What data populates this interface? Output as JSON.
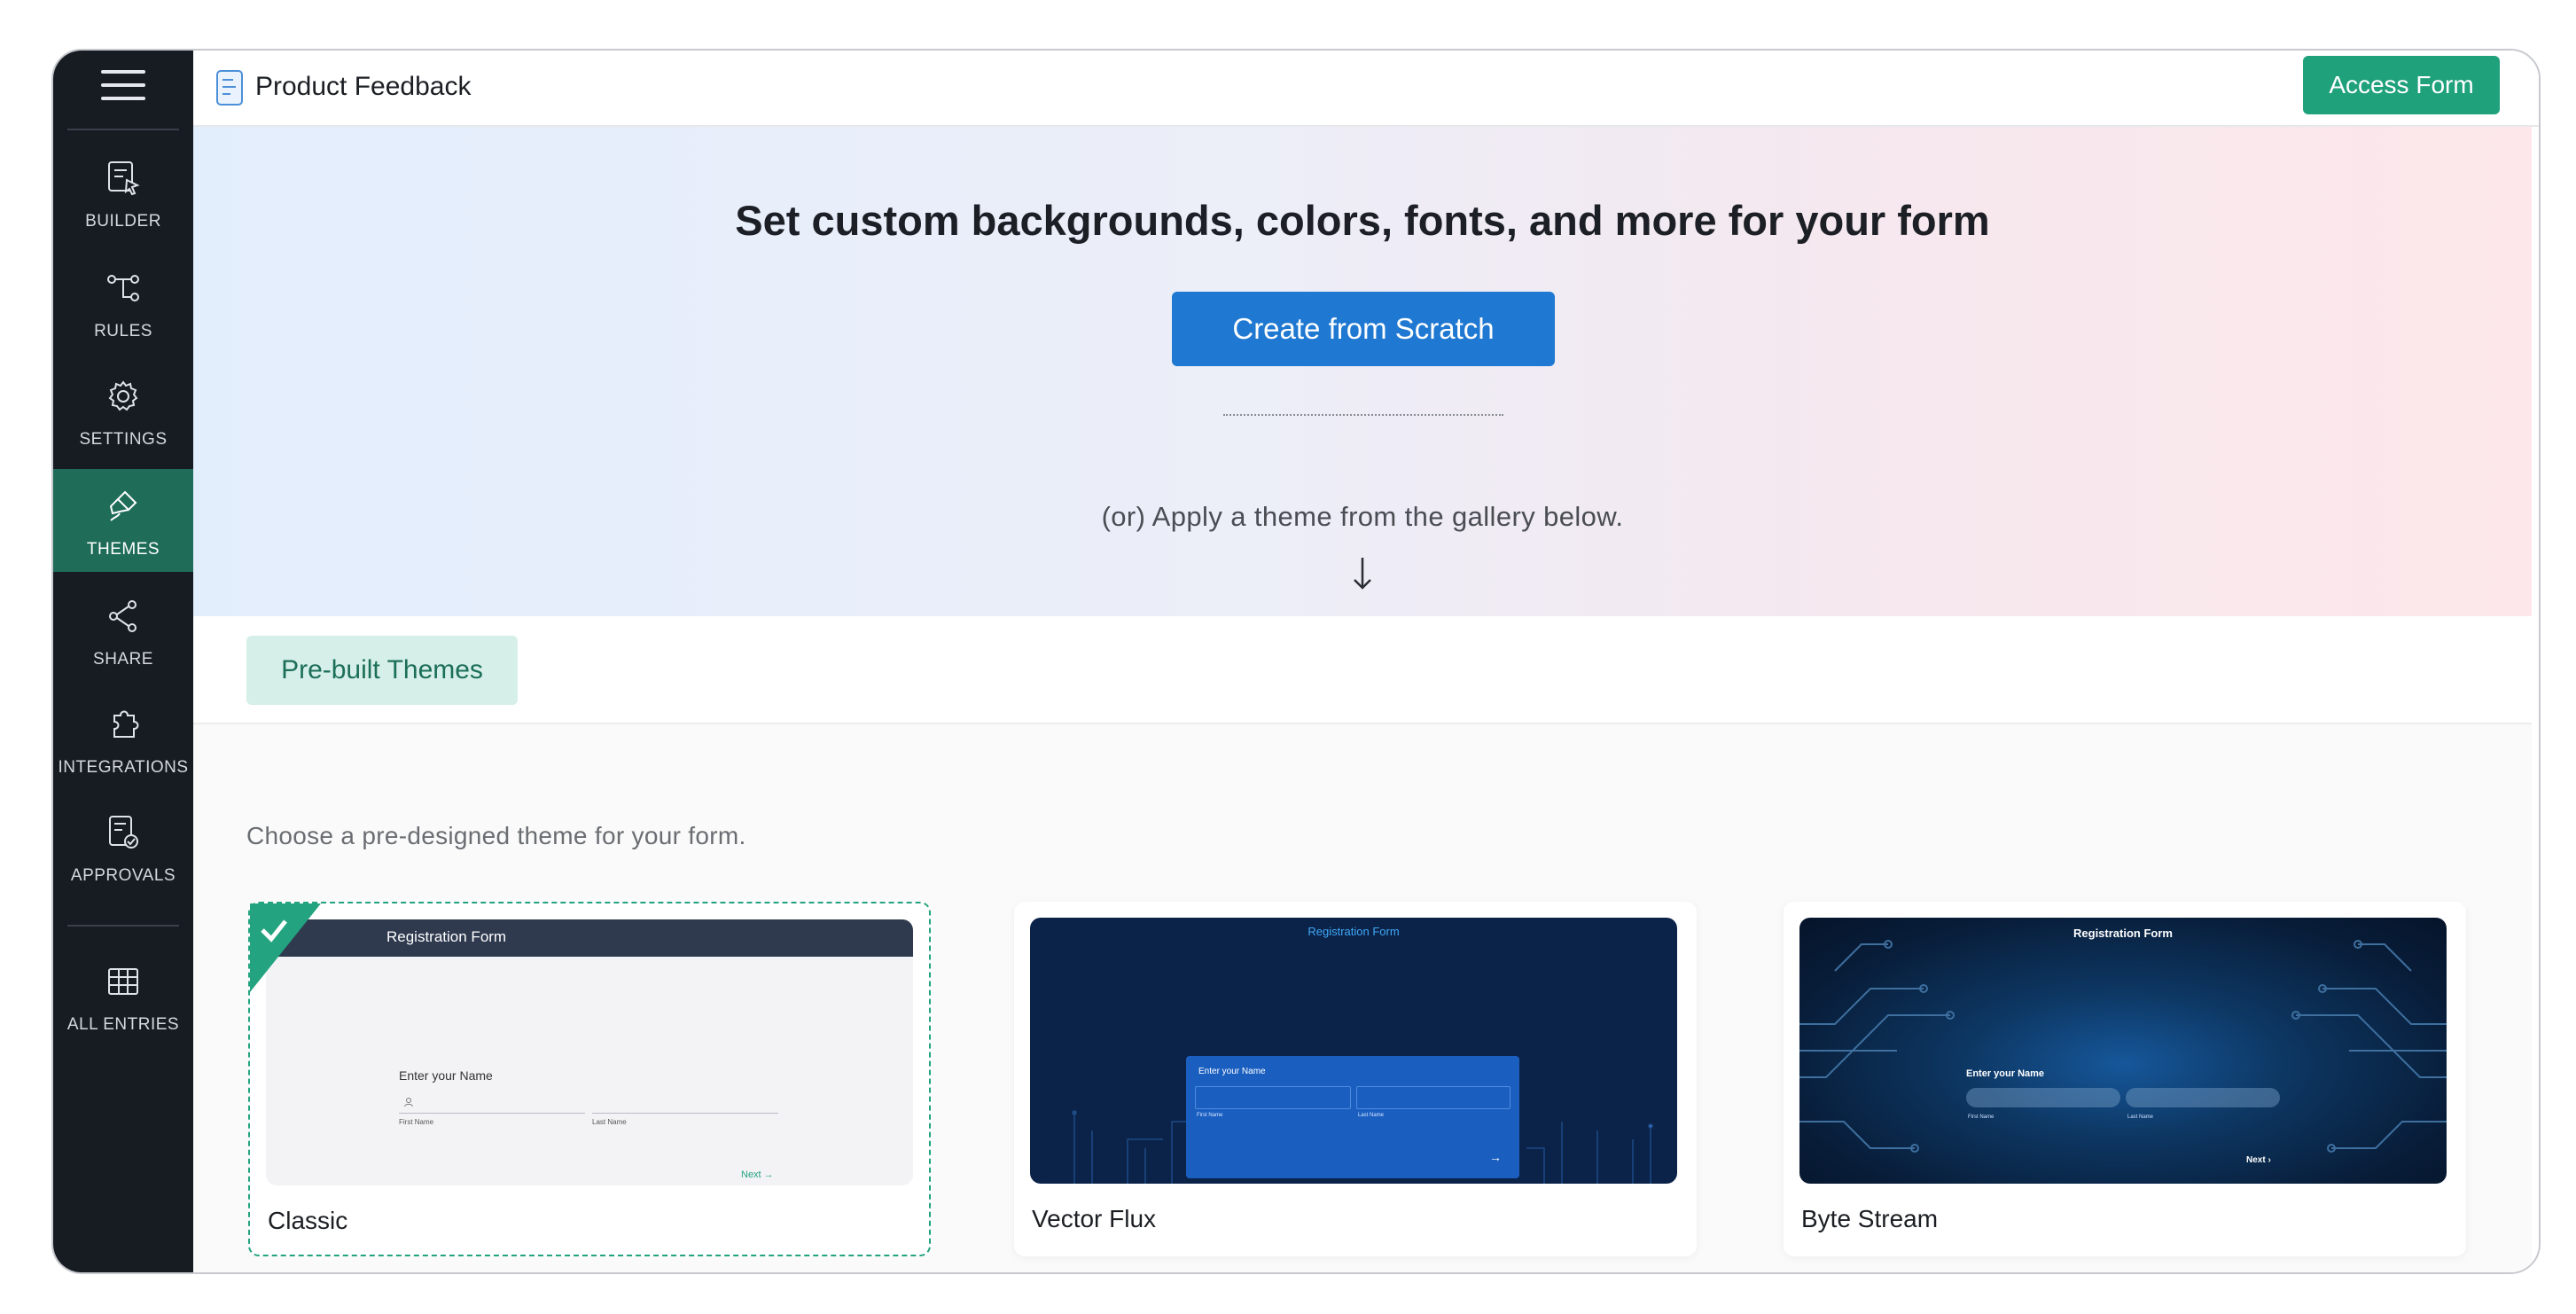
{
  "header": {
    "title": "Product Feedback",
    "access_form_label": "Access Form"
  },
  "sidebar": {
    "items": [
      {
        "label": "BUILDER",
        "icon": "builder-icon",
        "active": false
      },
      {
        "label": "RULES",
        "icon": "rules-icon",
        "active": false
      },
      {
        "label": "SETTINGS",
        "icon": "gear-icon",
        "active": false
      },
      {
        "label": "THEMES",
        "icon": "paint-brush-icon",
        "active": true
      },
      {
        "label": "SHARE",
        "icon": "share-icon",
        "active": false
      },
      {
        "label": "INTEGRATIONS",
        "icon": "puzzle-icon",
        "active": false
      },
      {
        "label": "APPROVALS",
        "icon": "approvals-icon",
        "active": false
      },
      {
        "label": "ALL ENTRIES",
        "icon": "table-grid-icon",
        "active": false
      }
    ]
  },
  "hero": {
    "title": "Set custom backgrounds, colors, fonts, and more for your form",
    "create_button": "Create from Scratch",
    "subtitle": "(or) Apply a theme from the gallery below."
  },
  "tabs": {
    "prebuilt": "Pre-built Themes"
  },
  "gallery": {
    "description": "Choose a pre-designed theme for your form.",
    "themes": [
      {
        "name": "Classic",
        "selected": true,
        "preview": {
          "form_title": "Registration Form",
          "question": "Enter your Name",
          "first": "First Name",
          "last": "Last Name",
          "next": "Next"
        }
      },
      {
        "name": "Vector Flux",
        "selected": false,
        "preview": {
          "form_title": "Registration Form",
          "question": "Enter your Name",
          "first": "First Name",
          "last": "Last Name"
        }
      },
      {
        "name": "Byte Stream",
        "selected": false,
        "preview": {
          "form_title": "Registration Form",
          "question": "Enter your Name",
          "first": "First Name",
          "last": "Last Name",
          "next": "Next"
        }
      }
    ]
  },
  "colors": {
    "sidebar_bg": "#171c23",
    "active_nav": "#1f6c58",
    "accent_green": "#1fa17c",
    "primary_blue": "#1f78d1"
  }
}
